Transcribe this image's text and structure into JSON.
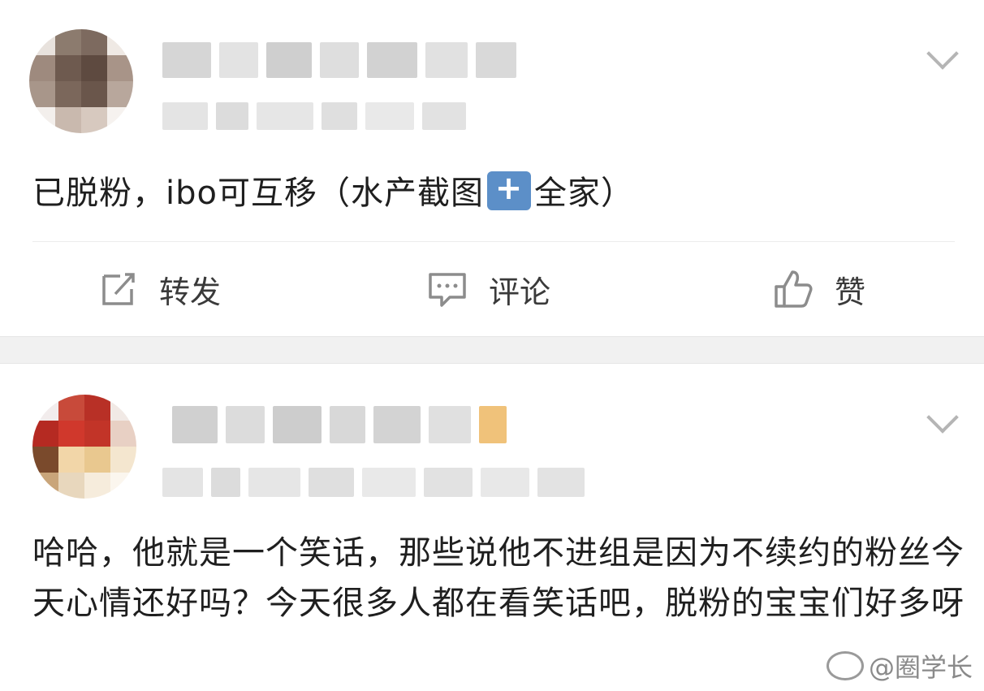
{
  "posts": [
    {
      "text_before": "已脱粉，ibo可互移（水产截图",
      "text_after": "全家）",
      "actions": {
        "repost_label": "转发",
        "comment_label": "评论",
        "like_label": "赞"
      }
    },
    {
      "text": "哈哈，他就是一个笑话，那些说他不进组是因为不续约的粉丝今天心情还好吗？今天很多人都在看笑话吧，脱粉的宝宝们好多呀"
    }
  ],
  "watermark": "@圈学长",
  "icons": [
    "repost-icon",
    "comment-icon",
    "like-icon",
    "chevron-down-icon",
    "sticker-icon",
    "weibo-logo-icon"
  ],
  "colors": {
    "background": "#ffffff",
    "separator": "#f1f1f1",
    "text": "#1f1f1f",
    "action_text": "#3a3a3a",
    "icon": "#8c8c8c",
    "sticker": "#5c8fc8"
  }
}
